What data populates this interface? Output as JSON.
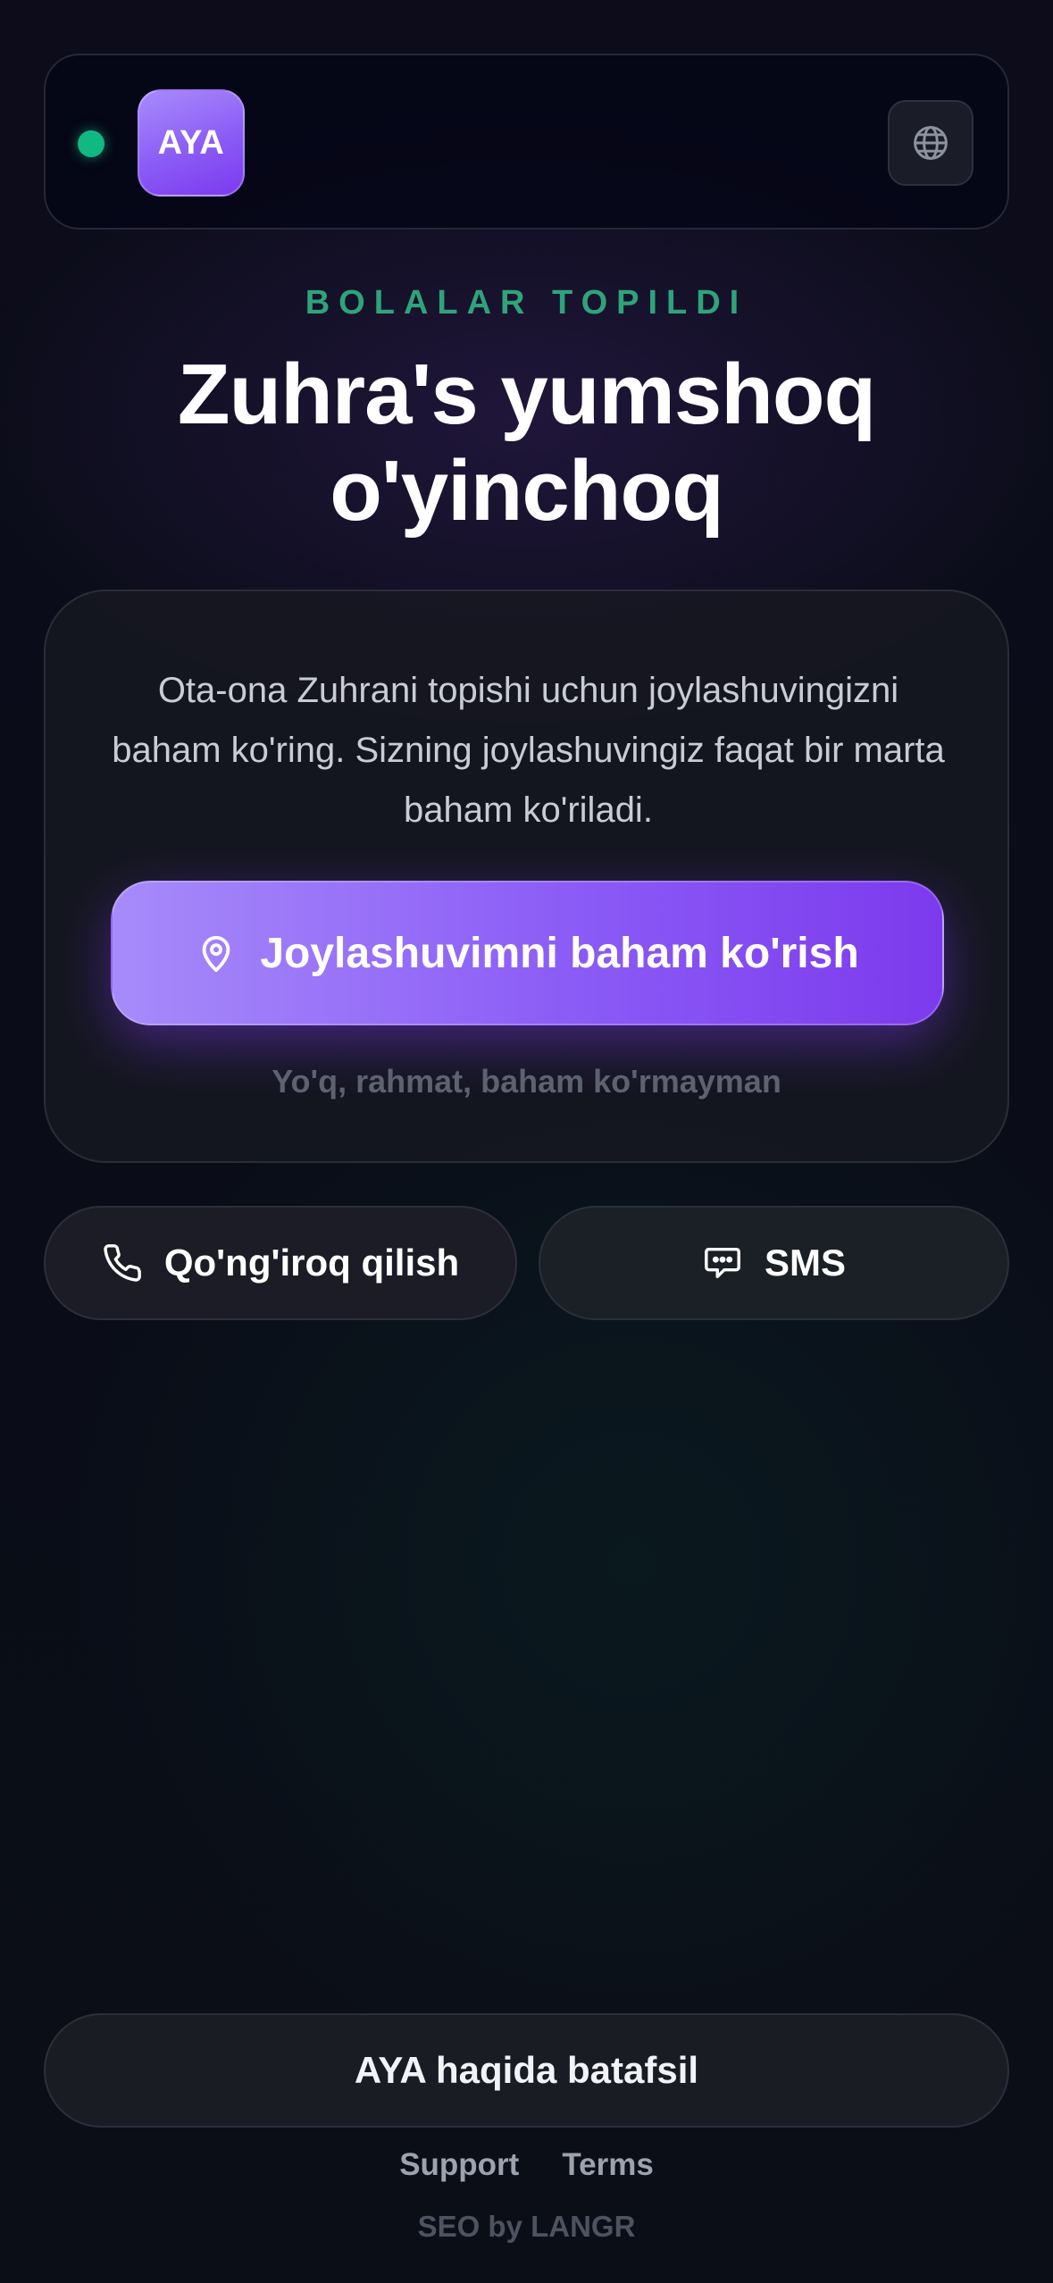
{
  "header": {
    "logo_text": "AYA",
    "status_color": "#10b981",
    "language_icon": "globe-icon"
  },
  "hero": {
    "eyebrow": "BOLALAR TOPILDI",
    "title": "Zuhra's yumshoq o'yinchoq"
  },
  "card": {
    "message": "Ota-ona Zuhrani topishi uchun joylashuvingizni baham ko'ring. Sizning joylashuvingiz faqat bir marta baham ko'riladi.",
    "share_button": {
      "label": "Joylashuvimni baham ko'rish",
      "icon": "map-pin-icon"
    },
    "decline_label": "Yo'q, rahmat, baham ko'rmayman"
  },
  "actions": {
    "call": {
      "label": "Qo'ng'iroq qilish",
      "icon": "phone-icon"
    },
    "sms": {
      "label": "SMS",
      "icon": "chat-bubble-icon"
    }
  },
  "footer": {
    "about_label": "AYA haqida batafsil",
    "links": [
      "Support",
      "Terms"
    ],
    "credit": "SEO by LANGR"
  },
  "colors": {
    "accent": "#8b5cf6",
    "eyebrow": "#2fa37a",
    "background": "#0c0c1a"
  }
}
